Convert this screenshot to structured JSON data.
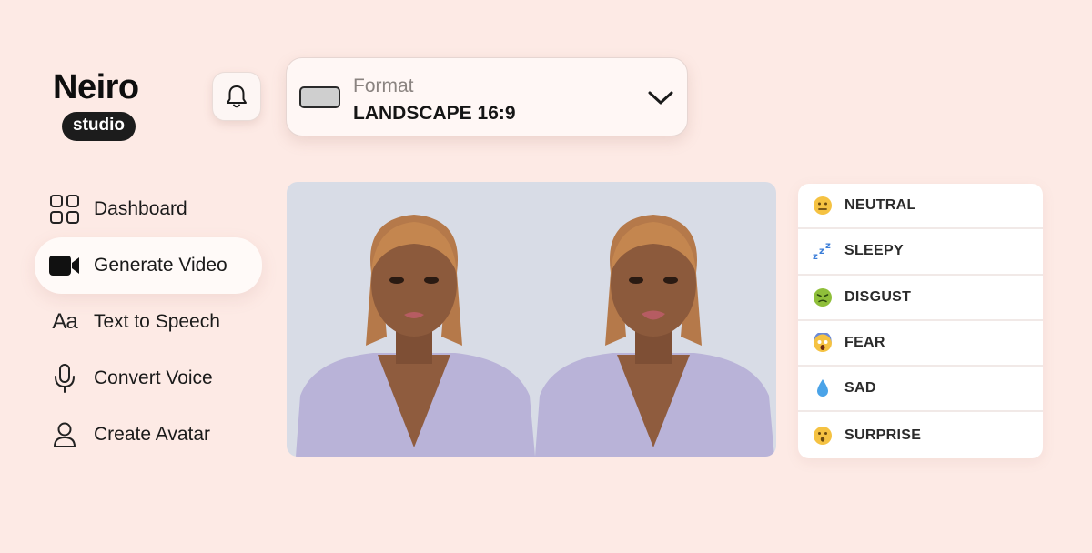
{
  "brand": {
    "name": "Neiro",
    "badge": "studio"
  },
  "header": {
    "bell_icon": "bell-icon",
    "format": {
      "label": "Format",
      "value": "LANDSCAPE 16:9",
      "icon": "rectangle-icon",
      "chevron": "chevron-down-icon"
    }
  },
  "sidebar": {
    "items": [
      {
        "label": "Dashboard",
        "icon": "grid-icon",
        "active": false
      },
      {
        "label": "Generate Video",
        "icon": "video-camera-icon",
        "active": true
      },
      {
        "label": "Text to Speech",
        "icon": "text-aa-icon",
        "glyph": "Aa",
        "active": false
      },
      {
        "label": "Convert Voice",
        "icon": "microphone-icon",
        "active": false
      },
      {
        "label": "Create Avatar",
        "icon": "user-icon",
        "active": false
      }
    ]
  },
  "preview": {
    "background": "#d8dce6",
    "avatars": 2
  },
  "emotions": [
    {
      "label": "NEUTRAL",
      "icon": "neutral-face-icon"
    },
    {
      "label": "SLEEPY",
      "icon": "zzz-icon"
    },
    {
      "label": "DISGUST",
      "icon": "nauseated-face-icon"
    },
    {
      "label": "FEAR",
      "icon": "screaming-face-icon"
    },
    {
      "label": "SAD",
      "icon": "droplet-icon"
    },
    {
      "label": "SURPRISE",
      "icon": "surprised-face-icon"
    }
  ],
  "colors": {
    "background": "#fdeae5",
    "accent": "#1c1c1c",
    "panel": "#ffffff"
  }
}
